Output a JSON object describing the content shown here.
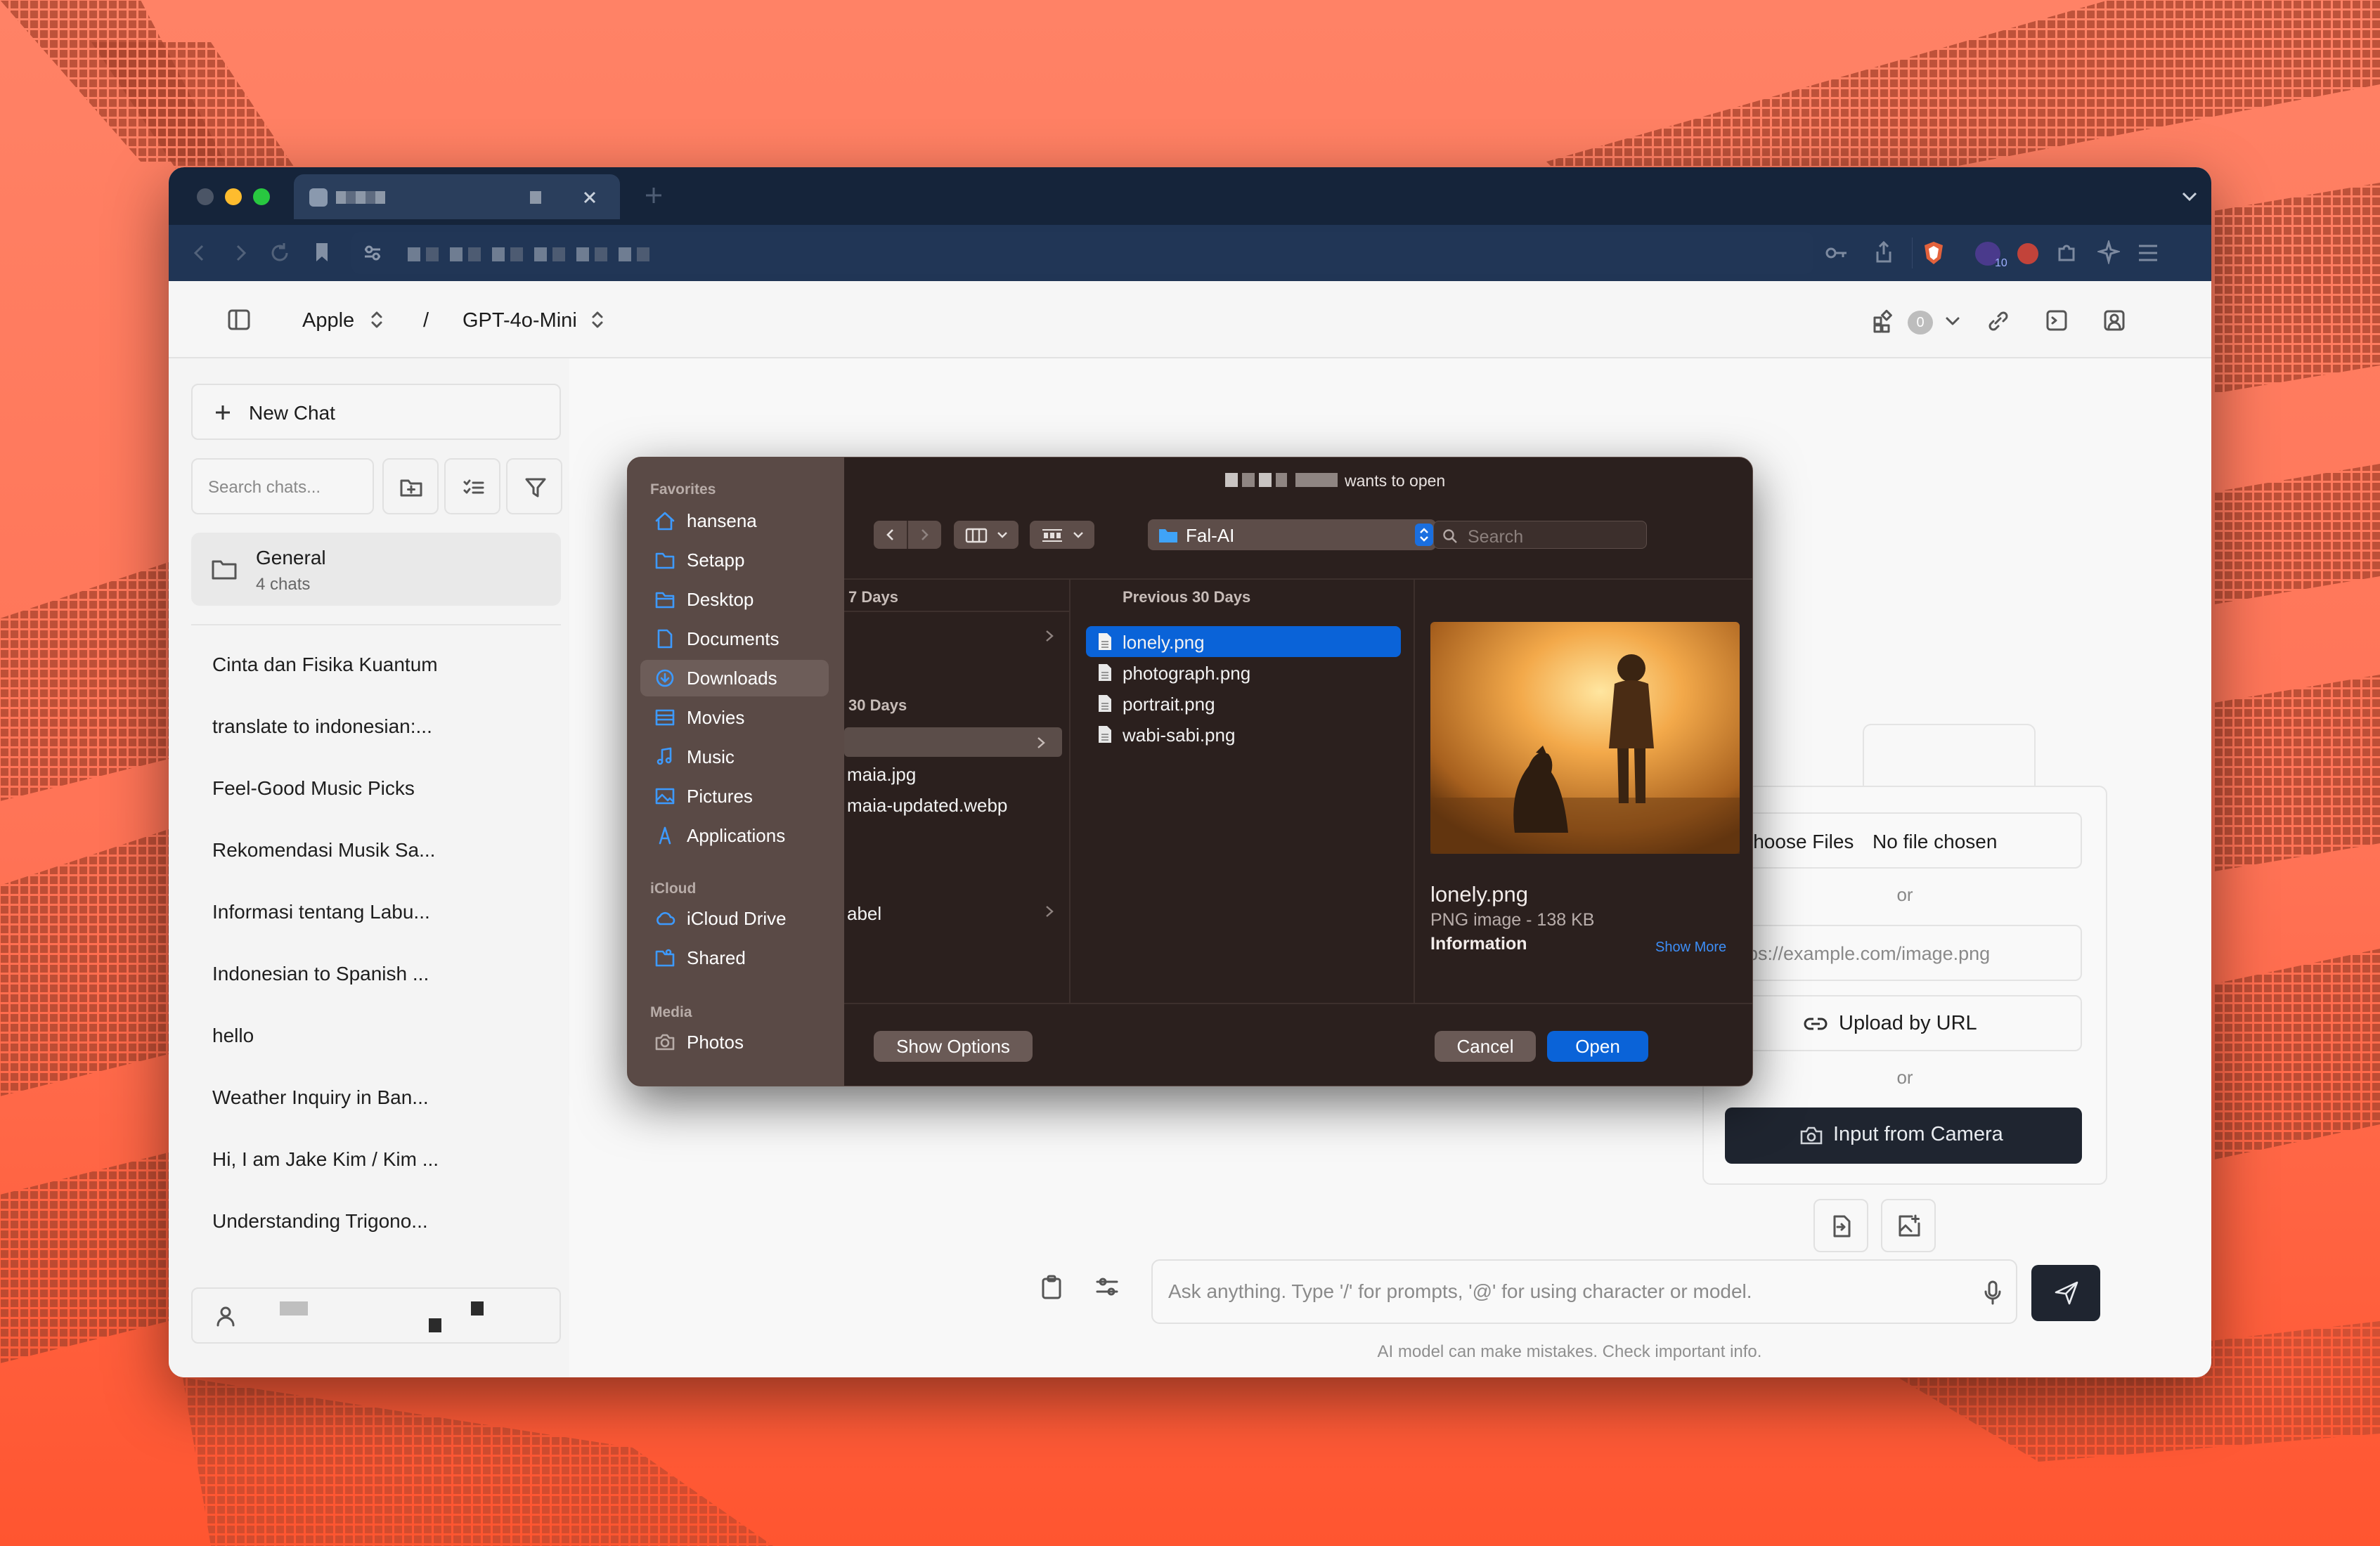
{
  "colors": {
    "accent": "#0a63d8",
    "dialog_bg": "#2b201e",
    "dark_button": "#1f2530",
    "titlebar": "#15243a"
  },
  "browser": {
    "tab_title": "",
    "address": "",
    "extension_badge": "10"
  },
  "app": {
    "workspace": "Apple",
    "separator": "/",
    "model": "GPT-4o-Mini",
    "badge_count": "0"
  },
  "sidebar": {
    "new_chat": "New Chat",
    "search_placeholder": "Search chats...",
    "folder": {
      "name": "General",
      "count": "4 chats"
    },
    "chats": [
      "Cinta dan Fisika Kuantum",
      "translate to indonesian:...",
      "Feel-Good Music Picks",
      "Rekomendasi Musik Sa...",
      "Informasi tentang Labu...",
      "Indonesian to Spanish ...",
      "hello",
      "Weather Inquiry in Ban...",
      "Hi, I am Jake Kim / Kim ...",
      "Understanding Trigono..."
    ]
  },
  "upload_panel": {
    "choose_files": "Choose Files",
    "no_file": "No file chosen",
    "or1": "or",
    "url_placeholder": "https://example.com/image.png",
    "upload_by_url": "Upload by URL",
    "or2": "or",
    "camera": "Input from Camera"
  },
  "composer": {
    "placeholder": "Ask anything.  Type '/' for prompts, '@' for using character or model.",
    "disclaimer": "AI model can make mistakes. Check important info."
  },
  "dialog": {
    "title_suffix": "wants to open",
    "location": "Fal-AI",
    "search_placeholder": "Search",
    "favorites_label": "Favorites",
    "favorites": [
      {
        "label": "hansena",
        "icon": "home-icon"
      },
      {
        "label": "Setapp",
        "icon": "folder-icon"
      },
      {
        "label": "Desktop",
        "icon": "desktop-icon"
      },
      {
        "label": "Documents",
        "icon": "document-icon"
      },
      {
        "label": "Downloads",
        "icon": "download-icon",
        "selected": true
      },
      {
        "label": "Movies",
        "icon": "film-icon"
      },
      {
        "label": "Music",
        "icon": "music-icon"
      },
      {
        "label": "Pictures",
        "icon": "picture-icon"
      },
      {
        "label": "Applications",
        "icon": "applications-icon"
      }
    ],
    "icloud_label": "iCloud",
    "icloud": [
      {
        "label": "iCloud Drive",
        "icon": "cloud-icon"
      },
      {
        "label": "Shared",
        "icon": "shared-folder-icon"
      }
    ],
    "media_label": "Media",
    "media": [
      {
        "label": "Photos",
        "icon": "camera-icon"
      }
    ],
    "col1": {
      "header_a": "7 Days",
      "header_b": "30 Days",
      "items": [
        "maia.jpg",
        "maia-updated.webp",
        "abel"
      ]
    },
    "col2": {
      "header": "Previous 30 Days",
      "files": [
        "lonely.png",
        "photograph.png",
        "portrait.png",
        "wabi-sabi.png"
      ],
      "selected": "lonely.png"
    },
    "preview": {
      "name": "lonely.png",
      "meta": "PNG image - 138 KB",
      "info": "Information",
      "show_more": "Show More"
    },
    "show_options": "Show Options",
    "cancel": "Cancel",
    "open": "Open"
  }
}
